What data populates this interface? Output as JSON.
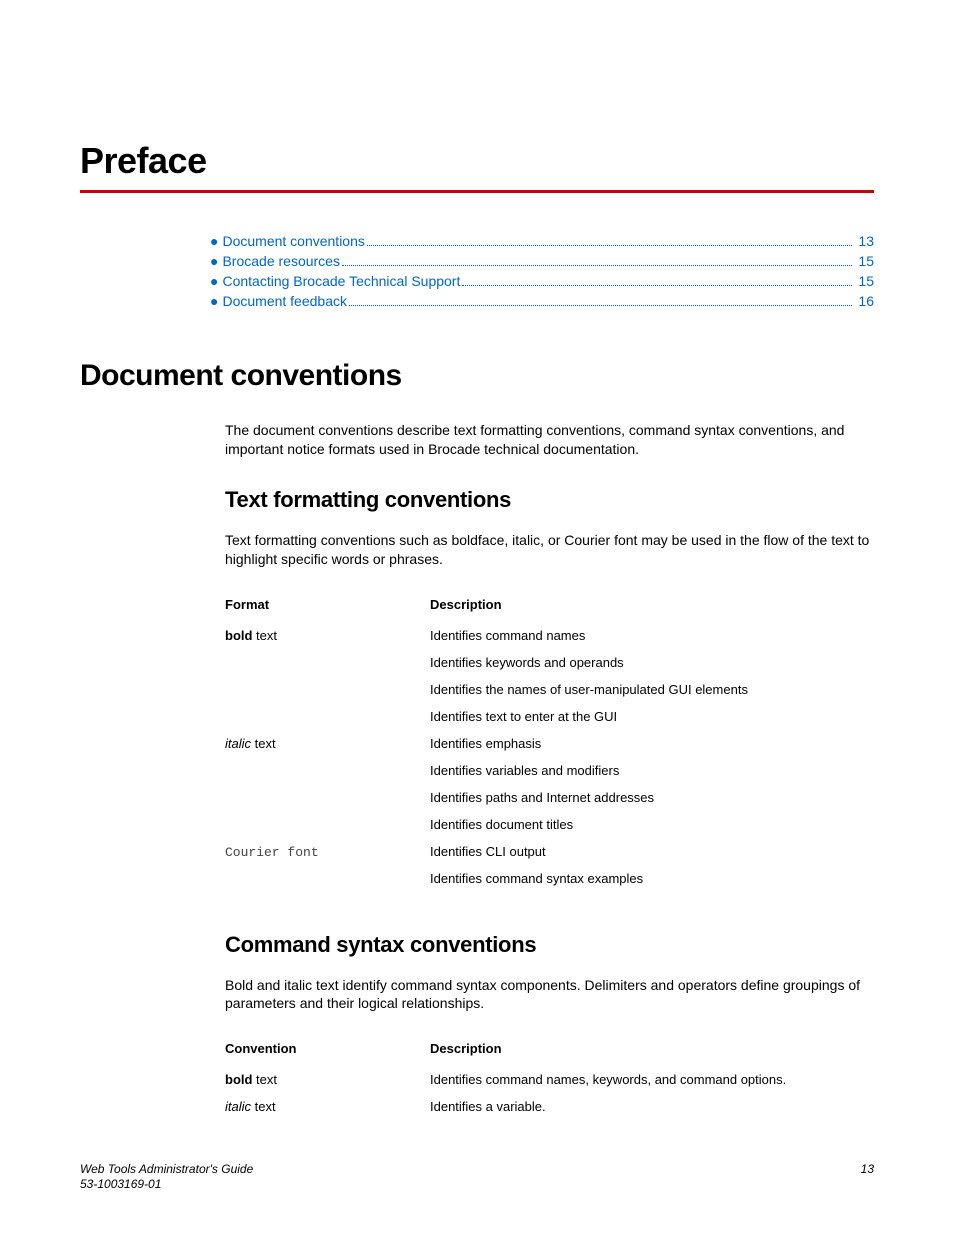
{
  "chapter_title": "Preface",
  "toc": [
    {
      "label": "Document conventions",
      "page": "13"
    },
    {
      "label": "Brocade resources",
      "page": "15"
    },
    {
      "label": "Contacting Brocade Technical Support",
      "page": "15"
    },
    {
      "label": "Document feedback",
      "page": "16"
    }
  ],
  "section1": {
    "title": "Document conventions",
    "intro": "The document conventions describe text formatting conventions, command syntax conventions, and important notice formats used in Brocade technical documentation."
  },
  "text_formatting": {
    "title": "Text formatting conventions",
    "intro": "Text formatting conventions such as boldface, italic, or Courier font may be used in the flow of the text to highlight specific words or phrases.",
    "headers": {
      "col1": "Format",
      "col2": "Description"
    },
    "rows": [
      {
        "format_bold": "bold",
        "format_rest": " text",
        "lines": [
          "Identifies command names",
          "Identifies keywords and operands",
          "Identifies the names of user-manipulated GUI elements",
          "Identifies text to enter at the GUI"
        ]
      },
      {
        "format_italic": "italic",
        "format_rest": " text",
        "lines": [
          "Identifies emphasis",
          "Identifies variables and modifiers",
          "Identifies paths and Internet addresses",
          "Identifies document titles"
        ]
      },
      {
        "format_courier": "Courier font",
        "lines": [
          "Identifies CLI output",
          "Identifies command syntax examples"
        ]
      }
    ]
  },
  "command_syntax": {
    "title": "Command syntax conventions",
    "intro": "Bold and italic text identify command syntax components. Delimiters and operators define groupings of parameters and their logical relationships.",
    "headers": {
      "col1": "Convention",
      "col2": "Description"
    },
    "rows": [
      {
        "format_bold": "bold",
        "format_rest": " text",
        "desc": "Identifies command names, keywords, and command options."
      },
      {
        "format_italic": "italic",
        "format_rest": " text",
        "desc": "Identifies a variable."
      }
    ]
  },
  "footer": {
    "doc_title": "Web Tools Administrator's Guide",
    "doc_number": "53-1003169-01",
    "page": "13"
  }
}
